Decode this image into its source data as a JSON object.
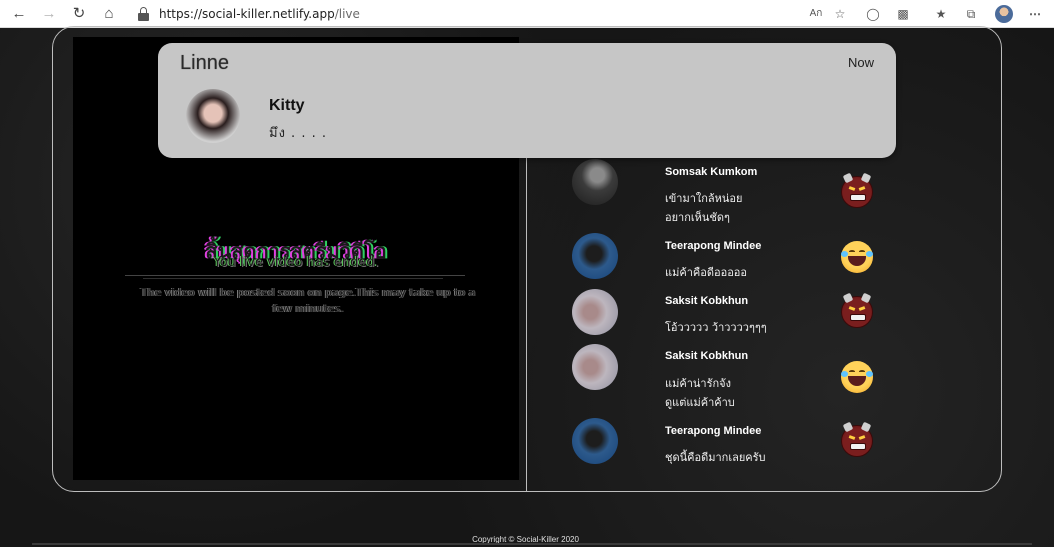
{
  "browser": {
    "url_domain": "https://social-killer.netlify.app",
    "url_path": "/live",
    "icons": {
      "back": "arrow-left-icon",
      "forward": "arrow-right-icon",
      "reload": "reload-icon",
      "home": "home-icon",
      "lock": "lock-icon",
      "read_aloud": "read-aloud-icon",
      "add_favorite": "star-plus-icon",
      "extension": "extension-icon",
      "collections": "collections-icon",
      "favorites": "favorites-icon",
      "tabs": "tab-actions-icon",
      "profile": "profile-avatar",
      "menu": "more-menu-icon"
    }
  },
  "video": {
    "ended_thai": "สิ้นสุดการสตรีมวิดีโอ",
    "ended_en": "You live video has ended.",
    "ended_sub": "The video will be posted soon on page.This may take up to a few minutes."
  },
  "comments": [
    {
      "name": "Somsak Kumkom",
      "lines": [
        "เข้ามาใกล้หน่อย",
        "อยากเห็นชัดๆ"
      ],
      "emoji": "angry-devil-emoji"
    },
    {
      "name": "Teerapong Mindee",
      "lines": [
        "แม่ค้าคือดีอออออ"
      ],
      "emoji": "laughing-tears-emoji"
    },
    {
      "name": "Saksit Kobkhun",
      "lines": [
        "โอ้ววววว ว้าววววๆๆๆ"
      ],
      "emoji": "angry-devil-emoji"
    },
    {
      "name": "Saksit Kobkhun",
      "lines": [
        "แม่ค้าน่ารักจัง",
        "ดูแต่แม่ค้าค้าบ"
      ],
      "emoji": "laughing-tears-emoji"
    },
    {
      "name": "Teerapong Mindee",
      "lines": [
        "ชุดนี้คือดีมากเลยครับ"
      ],
      "emoji": "angry-devil-emoji"
    }
  ],
  "notification": {
    "app_name": "Linne",
    "time": "Now",
    "sender": "Kitty",
    "message": "มึง . . . ."
  },
  "footer": {
    "copyright": "Copyright © Social-Killer 2020",
    "accent_text": "",
    "accent_color": "#b01515"
  },
  "colors": {
    "background": "#161616",
    "notification_bg": "#c6c6c6",
    "frame_border": "#bdbdbd"
  }
}
